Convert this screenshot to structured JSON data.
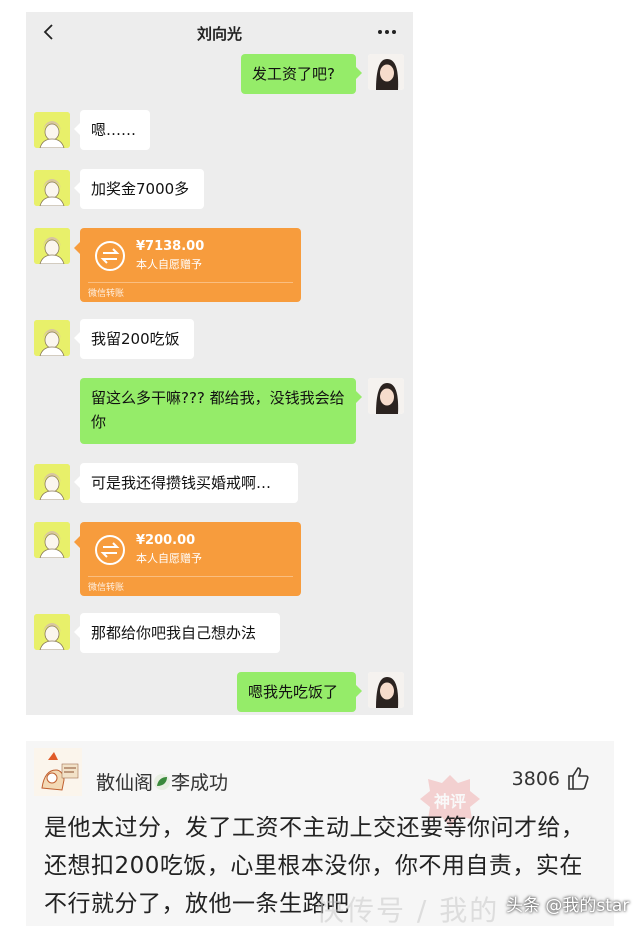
{
  "chat": {
    "title": "刘向光",
    "messages": [
      {
        "side": "right",
        "type": "text",
        "text": "发工资了吧?"
      },
      {
        "side": "left",
        "type": "text",
        "text": "嗯……"
      },
      {
        "side": "left",
        "type": "text",
        "text": "加奖金7000多"
      },
      {
        "side": "left",
        "type": "transfer",
        "amount": "¥7138.00",
        "note": "本人自愿赠予",
        "footer": "微信转账"
      },
      {
        "side": "left",
        "type": "text",
        "text": "我留200吃饭"
      },
      {
        "side": "right",
        "type": "text",
        "text": "留这么多干嘛??? 都给我，没钱我会给你"
      },
      {
        "side": "left",
        "type": "text",
        "text": "可是我还得攒钱买婚戒啊…"
      },
      {
        "side": "left",
        "type": "transfer",
        "amount": "¥200.00",
        "note": "本人自愿赠予",
        "footer": "微信转账"
      },
      {
        "side": "left",
        "type": "text",
        "text": "那都给你吧我自己想办法"
      },
      {
        "side": "right",
        "type": "text",
        "text": "嗯我先吃饭了"
      }
    ]
  },
  "comment": {
    "user_part1": "散仙阁",
    "user_part2": "李成功",
    "likes": "3806",
    "text": "是他太过分，发了工资不主动上交还要等你问才给，还想扣200吃饭，心里根本没你，你不用自责，实在不行就分了，放他一条生路吧",
    "stamp": "神评",
    "watermark": "快传号 / 我的",
    "source": "头条 @我的star"
  },
  "colors": {
    "chat_background": "#ededed",
    "self_bubble": "#95ec69",
    "other_bubble": "#ffffff",
    "transfer_card": "#f79c3d",
    "comment_background": "#f6f6f6"
  },
  "icons": [
    "back-icon",
    "more-icon",
    "transfer-icon",
    "leaf-icon",
    "thumb-up-icon"
  ]
}
